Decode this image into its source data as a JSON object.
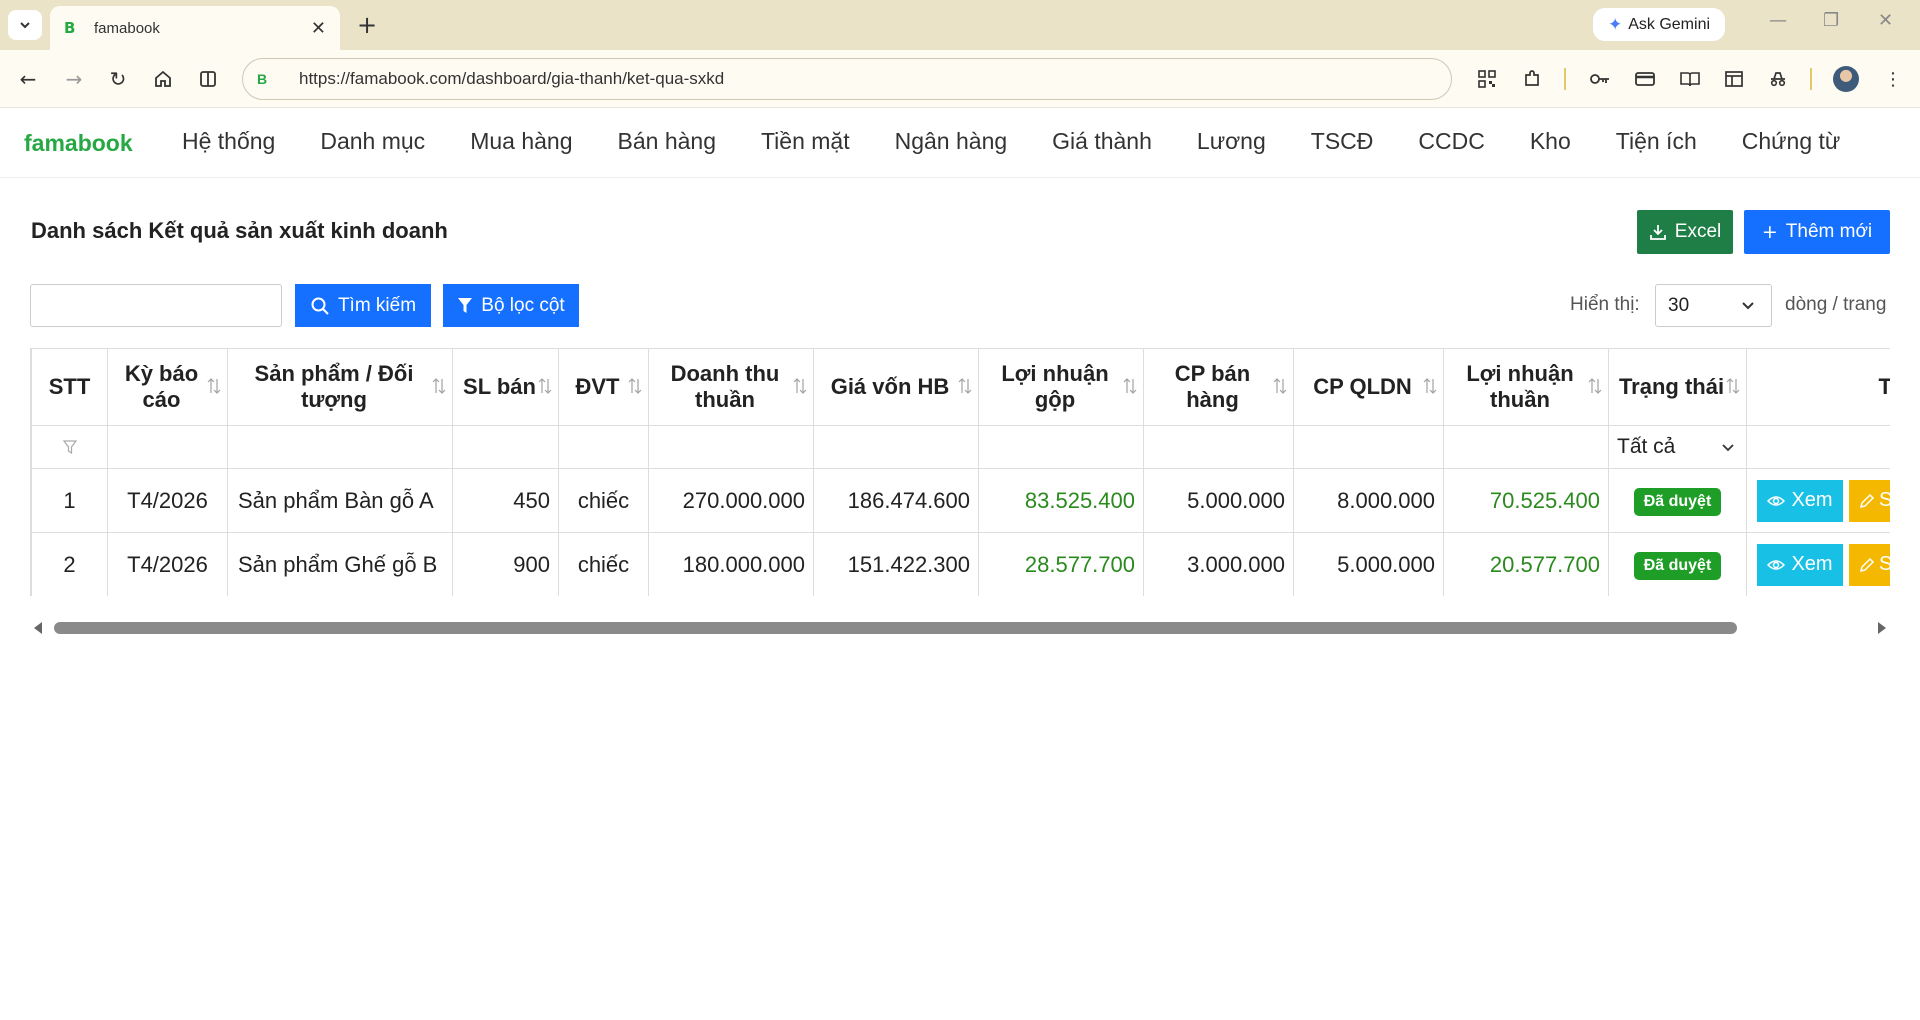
{
  "browser": {
    "tab_title": "famabook",
    "tab_favicon": "B",
    "ask_gemini": "Ask Gemini",
    "url": "https://famabook.com/dashboard/gia-thanh/ket-qua-sxkd"
  },
  "app": {
    "brand": "famabook",
    "menu": [
      "Hệ thống",
      "Danh mục",
      "Mua hàng",
      "Bán hàng",
      "Tiền mặt",
      "Ngân hàng",
      "Giá thành",
      "Lương",
      "TSCĐ",
      "CCDC",
      "Kho",
      "Tiện ích",
      "Chứng từ"
    ]
  },
  "page": {
    "title": "Danh sách Kết quả sản xuất kinh doanh",
    "excel_label": "Excel",
    "add_label": "Thêm mới",
    "search_placeholder": "",
    "search_label": "Tìm kiếm",
    "filter_label": "Bộ lọc cột",
    "show_label": "Hiển thị:",
    "page_size": "30",
    "rows_label": "dòng / trang"
  },
  "table": {
    "headers": [
      "STT",
      "Kỳ báo cáo",
      "Sản phẩm / Đối tượng",
      "SL bán",
      "ĐVT",
      "Doanh thu thuần",
      "Giá vốn HB",
      "Lợi nhuận gộp",
      "CP bán hàng",
      "CP QLDN",
      "Lợi nhuận thuần",
      "Trạng thái",
      "Thao"
    ],
    "status_filter": "Tất cả",
    "rows": [
      {
        "stt": "1",
        "period": "T4/2026",
        "product": "Sản phẩm Bàn gỗ A",
        "qty": "450",
        "unit": "chiếc",
        "revenue": "270.000.000",
        "cogs": "186.474.600",
        "gross": "83.525.400",
        "selling": "5.000.000",
        "admin": "8.000.000",
        "net": "70.525.400",
        "status": "Đã duyệt",
        "view": "Xem",
        "edit": "S"
      },
      {
        "stt": "2",
        "period": "T4/2026",
        "product": "Sản phẩm Ghế gỗ B",
        "qty": "900",
        "unit": "chiếc",
        "revenue": "180.000.000",
        "cogs": "151.422.300",
        "gross": "28.577.700",
        "selling": "3.000.000",
        "admin": "5.000.000",
        "net": "20.577.700",
        "status": "Đã duyệt",
        "view": "Xem",
        "edit": "S"
      }
    ]
  },
  "colors": {
    "brand": "#27a844",
    "primary": "#1570ff",
    "excel": "#1e7e45",
    "view": "#18c0e6",
    "edit": "#f5b800",
    "profit": "#2b8a1e"
  }
}
